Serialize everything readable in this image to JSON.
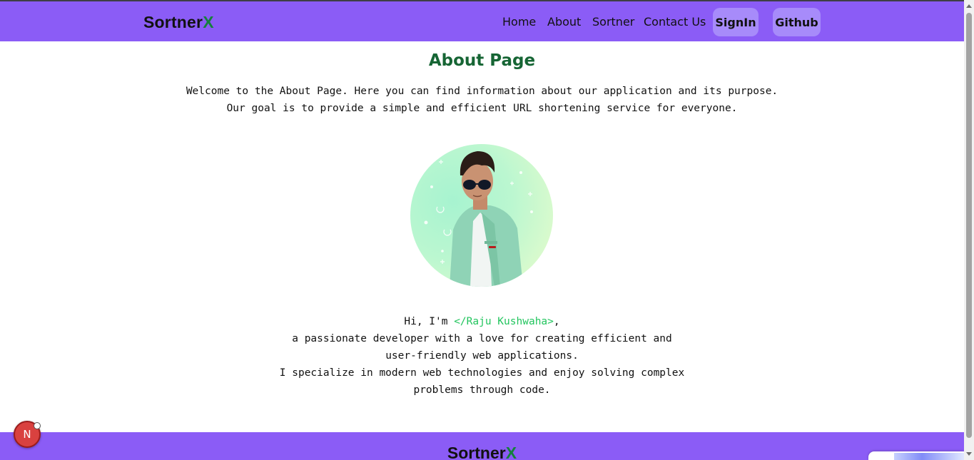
{
  "navbar": {
    "brand_main": "Sortner",
    "brand_accent": "X",
    "links": [
      "Home",
      "About",
      "Sortner",
      "Contact Us"
    ],
    "signin_label": "SignIn",
    "github_label": "Github"
  },
  "about": {
    "title": "About Page",
    "intro_line1": "Welcome to the About Page. Here you can find information about our application and its purpose.",
    "intro_line2": "Our goal is to provide a simple and efficient URL shortening service for everyone."
  },
  "bio": {
    "greeting_prefix": "Hi, I'm ",
    "name": "</Raju Kushwaha>",
    "greeting_suffix": ",",
    "line2": "a passionate developer with a love for creating efficient and",
    "line3": "user-friendly web applications.",
    "line4": "I specialize in modern web technologies and enjoy solving complex",
    "line5": "problems through code."
  },
  "footer": {
    "brand_main": "Sortner",
    "brand_accent": "X"
  },
  "dev_badge": {
    "letter": "N"
  },
  "colors": {
    "nav_bg": "#8b5cf6",
    "button_bg": "#a78bfa",
    "title_green": "#166534",
    "brand_accent": "#15803d",
    "name_green": "#22c55e"
  },
  "icons": [
    "nextjs-dev-indicator-icon"
  ]
}
